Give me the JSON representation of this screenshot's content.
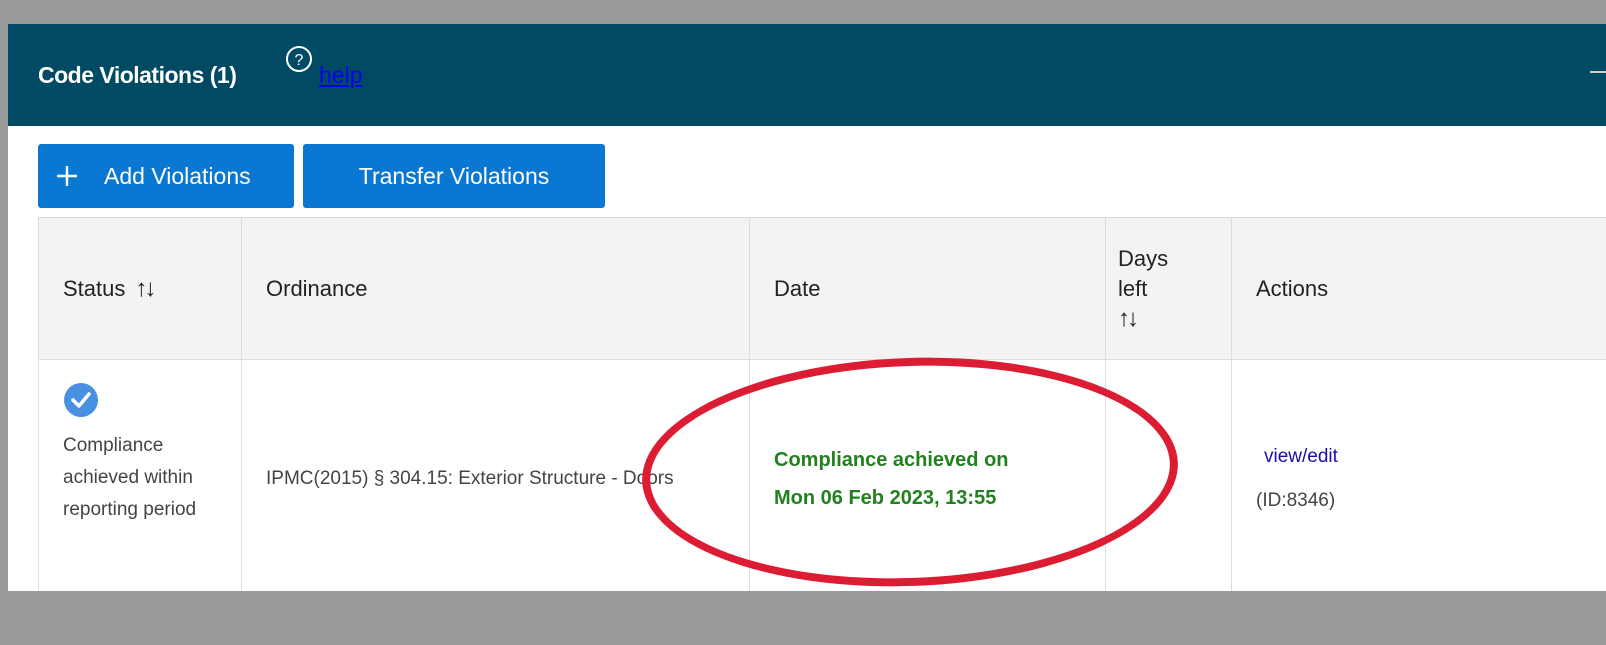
{
  "panel": {
    "title": "Code Violations (1)",
    "help_label": "help"
  },
  "toolbar": {
    "add_label": "Add Violations",
    "transfer_label": "Transfer Violations"
  },
  "table": {
    "headers": {
      "status": "Status",
      "ordinance": "Ordinance",
      "date": "Date",
      "days_left": "Days left",
      "actions": "Actions",
      "sort_glyph": "↑↓"
    },
    "rows": [
      {
        "status": "Compliance achieved within reporting period",
        "ordinance": "IPMC(2015) § 304.15: Exterior Structure - Doors",
        "date_line1": "Compliance achieved on",
        "date_line2": "Mon 06 Feb 2023, 13:55",
        "days_left": "",
        "action_link": "view/edit",
        "action_id": "(ID:8346)"
      }
    ]
  },
  "colors": {
    "header_bg": "#004a63",
    "button_bg": "#0a78d2",
    "compliance_green": "#22801f",
    "annotation_red": "#dc1c33",
    "check_blue": "#4a90e2"
  },
  "icons": {
    "help": "help-circle-icon",
    "add": "plus-icon",
    "sort": "sort-arrows-icon",
    "status": "check-circle-icon"
  }
}
